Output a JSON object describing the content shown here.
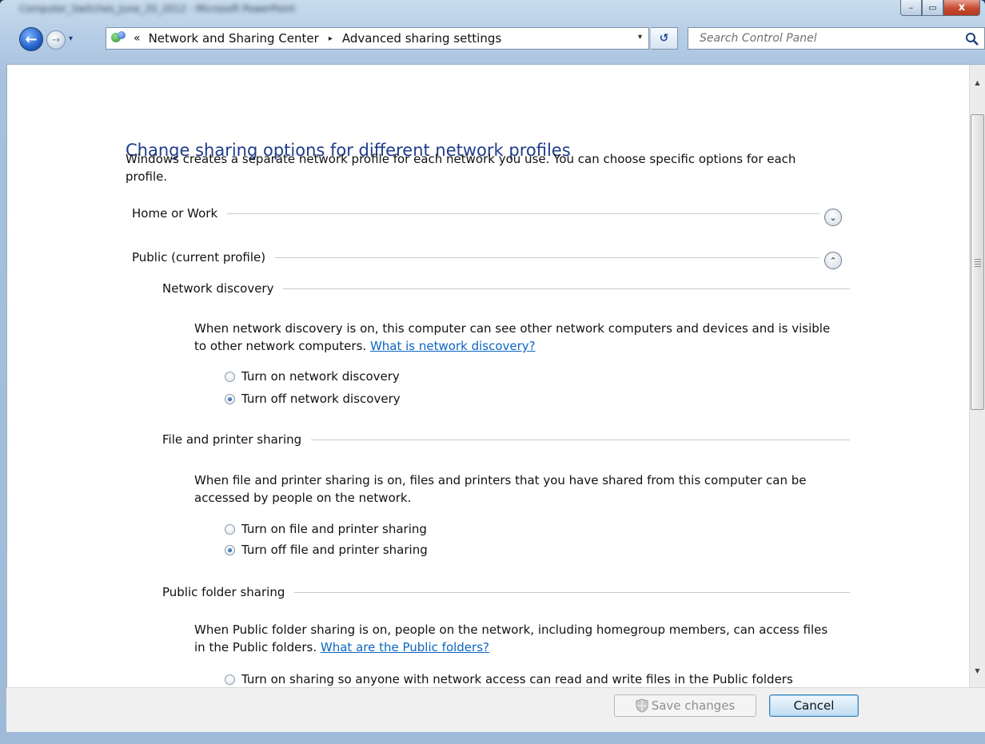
{
  "window": {
    "title": "Computer_Switches_June_20_2012 - Microsoft PowerPoint",
    "caption_minimize": "–",
    "caption_maximize": "▭",
    "caption_close": "x"
  },
  "nav": {
    "overflow_chevron": "«",
    "breadcrumbs": [
      "Network and Sharing Center",
      "Advanced sharing settings"
    ],
    "separator": "▸",
    "dropdown_glyph": "▾",
    "refresh_glyph": "↺"
  },
  "search": {
    "placeholder": "Search Control Panel"
  },
  "main": {
    "heading": "Change sharing options for different network profiles",
    "intro": "Windows creates a separate network profile for each network you use. You can choose specific options for each profile.",
    "profiles": [
      {
        "label": "Home or Work",
        "expanded": false,
        "toggle_glyph": "⌄"
      },
      {
        "label": "Public (current profile)",
        "expanded": true,
        "toggle_glyph": "⌃"
      }
    ],
    "sections": [
      {
        "title": "Network discovery",
        "description": "When network discovery is on, this computer can see other network computers and devices and is visible to other network computers.",
        "link": "What is network discovery?",
        "options": [
          {
            "label": "Turn on network discovery",
            "checked": false
          },
          {
            "label": "Turn off network discovery",
            "checked": true
          }
        ]
      },
      {
        "title": "File and printer sharing",
        "description": "When file and printer sharing is on, files and printers that you have shared from this computer can be accessed by people on the network.",
        "link": "",
        "options": [
          {
            "label": "Turn on file and printer sharing",
            "checked": false
          },
          {
            "label": "Turn off file and printer sharing",
            "checked": true
          }
        ]
      },
      {
        "title": "Public folder sharing",
        "description": "When Public folder sharing is on, people on the network, including homegroup members, can access files in the Public folders.",
        "link": "What are the Public folders?",
        "options": [
          {
            "label": "Turn on sharing so anyone with network access can read and write files in the Public folders",
            "checked": false
          }
        ]
      }
    ]
  },
  "footer": {
    "save_label": "Save changes",
    "save_enabled": false,
    "cancel_label": "Cancel"
  },
  "colors": {
    "heading": "#1e3c8c",
    "link": "#0b66c2",
    "frame": "#b7cee6"
  }
}
